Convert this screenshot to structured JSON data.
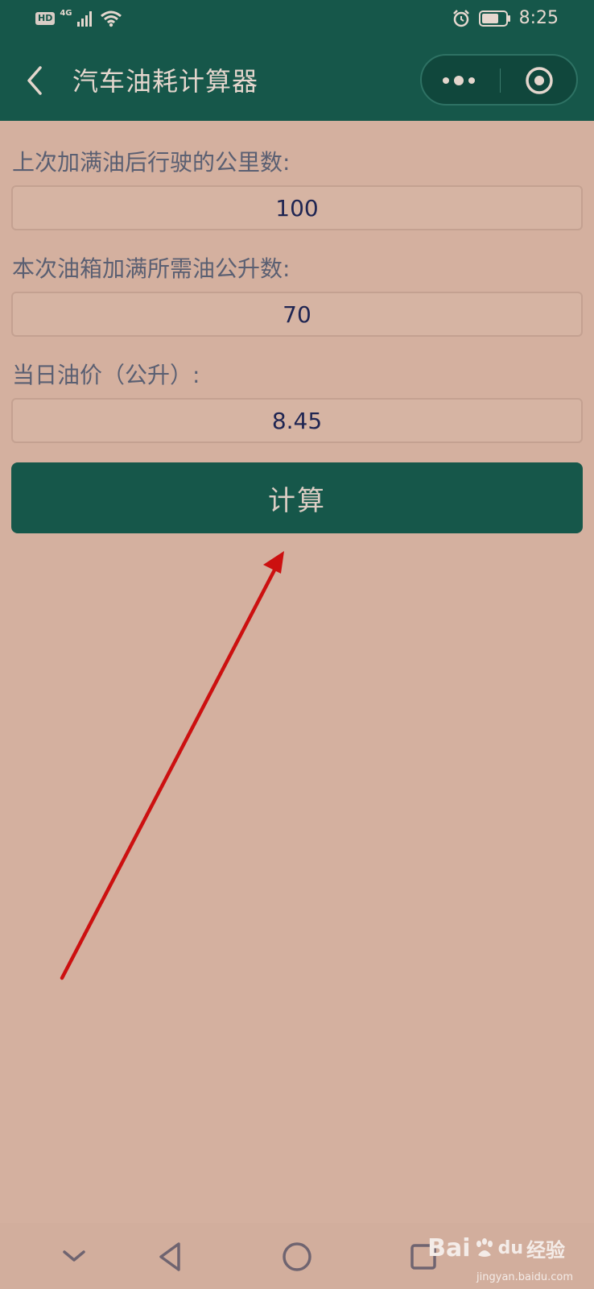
{
  "status_bar": {
    "hd": "HD",
    "network": "4G",
    "time": "8:25"
  },
  "header": {
    "title": "汽车油耗计算器"
  },
  "form": {
    "distance_label": "上次加满油后行驶的公里数:",
    "distance_value": "100",
    "fuel_label": "本次油箱加满所需油公升数:",
    "fuel_value": "70",
    "price_label": "当日油价（公升）:",
    "price_value": "8.45",
    "calculate_label": "计算"
  },
  "watermark": {
    "brand_bai": "Bai",
    "brand_du": "du",
    "brand_cn": "经验",
    "url": "jingyan.baidu.com"
  },
  "icons": [
    "hd-badge",
    "signal-icon",
    "wifi-icon",
    "alarm-icon",
    "battery-icon",
    "back-icon",
    "more-icon",
    "close-mini-program-icon",
    "nav-down-icon",
    "nav-back-icon",
    "nav-home-icon",
    "nav-recent-icon"
  ],
  "colors": {
    "header": "#16574a",
    "background": "#d4b09f",
    "button": "#16574a",
    "arrow": "#cc1010"
  }
}
